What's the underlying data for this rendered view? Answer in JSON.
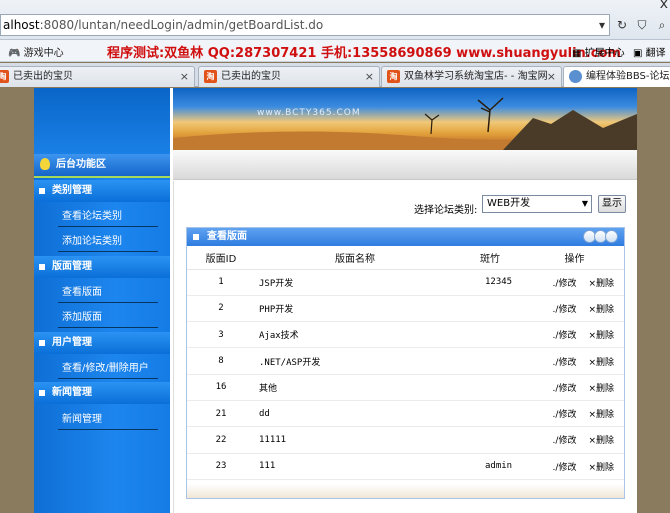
{
  "browser": {
    "url_host": "alhost",
    "url_rest": ":8080/luntan/needLogin/admin/getBoardList.do",
    "close_glyph": "x"
  },
  "bookmarks": {
    "games": "游戏中心",
    "ad": "程序测试:双鱼林 QQ:287307421 手机:13558690869 www.shuangyulin.com",
    "extension": "扩展中心",
    "translate": "翻译"
  },
  "tabs": [
    {
      "label": "已卖出的宝贝"
    },
    {
      "label": "已卖出的宝贝"
    },
    {
      "label": "双鱼林学习系统淘宝店- - 淘宝网"
    },
    {
      "label": "编程体验BBS-论坛 后"
    }
  ],
  "banner": {
    "watermark": "www.BCTY365.COM"
  },
  "sidebar": {
    "title": "后台功能区",
    "sections": [
      {
        "label": "类别管理",
        "items": [
          "查看论坛类别",
          "添加论坛类别"
        ]
      },
      {
        "label": "版面管理",
        "items": [
          "查看版面",
          "添加版面"
        ]
      },
      {
        "label": "用户管理",
        "items": [
          "查看/修改/删除用户"
        ]
      },
      {
        "label": "新闻管理",
        "items": [
          "新闻管理"
        ]
      }
    ]
  },
  "filter": {
    "label": "选择论坛类别:",
    "selected": "WEB开发",
    "button": "显示"
  },
  "panel": {
    "title": "查看版面",
    "columns": [
      "版面ID",
      "版面名称",
      "斑竹",
      "操作"
    ],
    "edit_label": "./修改",
    "delete_label": "×删除",
    "rows": [
      {
        "id": "1",
        "name": "JSP开发",
        "mod": "12345"
      },
      {
        "id": "2",
        "name": "PHP开发",
        "mod": ""
      },
      {
        "id": "3",
        "name": "Ajax技术",
        "mod": ""
      },
      {
        "id": "8",
        "name": ".NET/ASP开发",
        "mod": ""
      },
      {
        "id": "16",
        "name": "其他",
        "mod": ""
      },
      {
        "id": "21",
        "name": "dd",
        "mod": ""
      },
      {
        "id": "22",
        "name": "11111",
        "mod": ""
      },
      {
        "id": "23",
        "name": "111",
        "mod": "admin"
      }
    ]
  }
}
